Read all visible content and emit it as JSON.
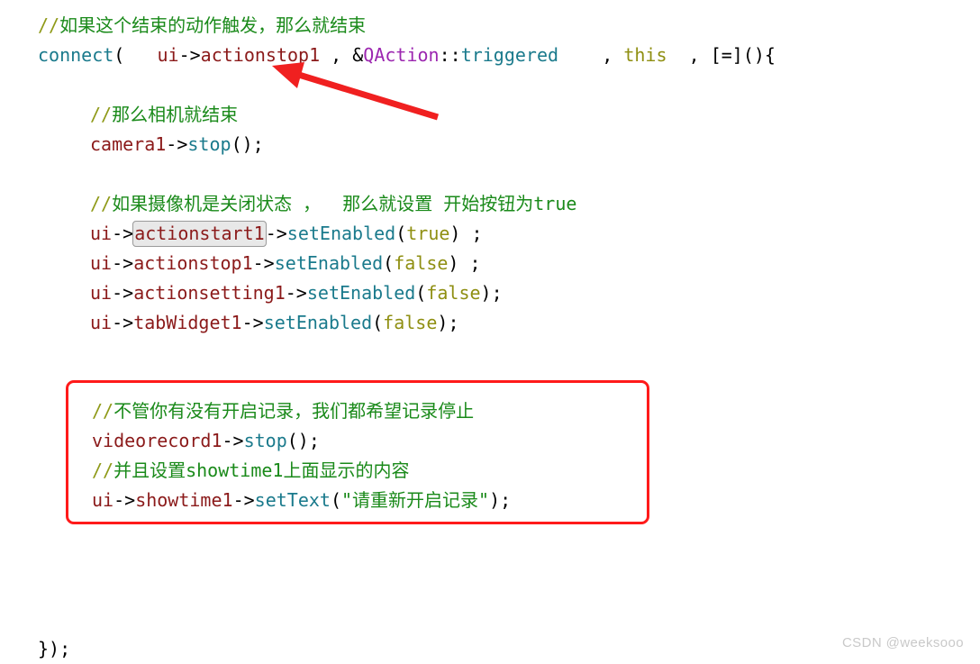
{
  "document": {
    "kind": "code-snippet-screenshot",
    "language": "C++ / Qt"
  },
  "code": {
    "lines": [
      {
        "id": "line-comment-trigger",
        "indent": 0,
        "text": "//如果这个结束的动作触发，那么就结束"
      },
      {
        "id": "line-connect",
        "indent": 0,
        "text": "connect(  ui->actionstop1 , &QAction::triggered   , this  , [=](){"
      },
      {
        "id": "line-comment-camera",
        "indent": 1,
        "text": "//那么相机就结束"
      },
      {
        "id": "line-camera-stop",
        "indent": 1,
        "text": "camera1->stop();"
      },
      {
        "id": "line-comment-enable",
        "indent": 1,
        "text": "//如果摄像机是关闭状态 ，  那么就设置 开始按钮为true"
      },
      {
        "id": "line-actionstart1",
        "indent": 1,
        "text": "ui->actionstart1->setEnabled(true) ;"
      },
      {
        "id": "line-actionstop1",
        "indent": 1,
        "text": "ui->actionstop1->setEnabled(false) ;"
      },
      {
        "id": "line-actionsetting1",
        "indent": 1,
        "text": "ui->actionsetting1->setEnabled(false);"
      },
      {
        "id": "line-tabwidget1",
        "indent": 1,
        "text": "ui->tabWidget1->setEnabled(false);"
      },
      {
        "id": "line-comment-record",
        "indent": 1,
        "text": "//不管你有没有开启记录，我们都希望记录停止"
      },
      {
        "id": "line-videorecord-stop",
        "indent": 1,
        "text": "videorecord1->stop();"
      },
      {
        "id": "line-comment-showtime",
        "indent": 1,
        "text": "//并且设置showtime1上面显示的内容"
      },
      {
        "id": "line-showtime-settext",
        "indent": 1,
        "text": "ui->showtime1->setText(\"请重新开启记录\");"
      },
      {
        "id": "line-closing",
        "indent": 0,
        "text": "});"
      }
    ],
    "tokens": {
      "comment_slashes": "//",
      "comment_trigger_body": "如果这个结束的动作触发，那么就结束",
      "comment_camera_body": "那么相机就结束",
      "comment_enable_body": "如果摄像机是关闭状态 ，  那么就设置 开始按钮为true",
      "comment_record_body": "不管你有没有开启记录，我们都希望记录停止",
      "comment_showtime_body": "并且设置showtime1上面显示的内容",
      "connect_func": "connect",
      "open_paren": "(",
      "close_paren": ")",
      "spaces_2": "  ",
      "ui": "ui",
      "arrow": "->",
      "actionstop1": "actionstop1",
      "actionstart1": "actionstart1",
      "actionsetting1": "actionsetting1",
      "tabWidget1": "tabWidget1",
      "showtime1": "showtime1",
      "camera1": "camera1",
      "videorecord1": "videorecord1",
      "comma": ",",
      "ampersand": "&",
      "qaction": "QAction",
      "scope": "::",
      "triggered": "triggered",
      "this_kw": "this",
      "lambda_capture": "[=]",
      "empty_parens": "()",
      "open_brace": "{",
      "stop": "stop",
      "semicolon": ";",
      "setEnabled": "setEnabled",
      "setText": "setText",
      "true_lit": "true",
      "false_lit": "false",
      "string_showtime": "\"请重新开启记录\"",
      "closing_brace_paren_semi": "});",
      "space": " ",
      "space_3": "   "
    }
  },
  "annotations": {
    "red_box": {
      "name": "red-highlight-rectangle",
      "color": "#ff1a1a",
      "encloses": "videorecord1 stop and showtime1 setText block"
    },
    "red_arrow": {
      "name": "red-pointer-arrow",
      "color": "#f02020",
      "points_at": "ui->actionstop1",
      "direction": "up-left"
    },
    "identifier_highlight": {
      "name": "actionstart1-hover-highlight",
      "text": "actionstart1",
      "background": "#e8e8e8",
      "border": "#9a9a9a"
    }
  },
  "watermark": {
    "text": "CSDN @weeksooo"
  },
  "palette": {
    "comment": "#1a8a1a",
    "comment_slash": "#8f9a18",
    "function": "#1a7a8c",
    "type": "#9c27b0",
    "member": "#8b1a1a",
    "keyword": "#8f8f12",
    "string": "#1a8a1a",
    "punct": "#000000",
    "annotation_red": "#ff1a1a",
    "background": "#ffffff"
  }
}
